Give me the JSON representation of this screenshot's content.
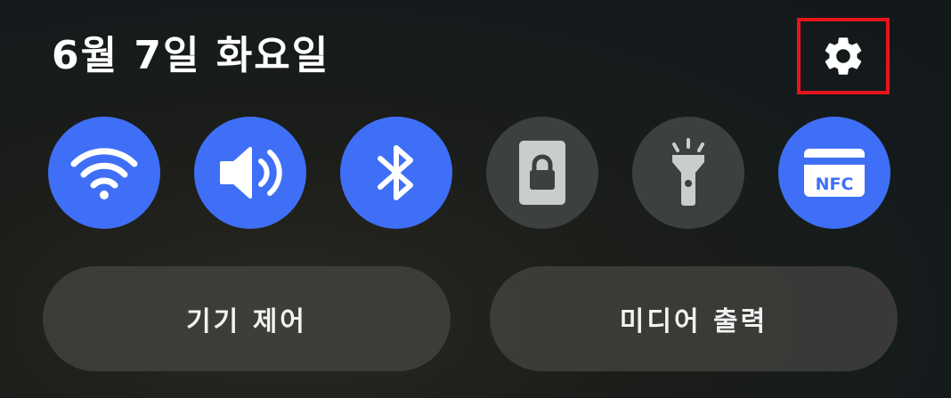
{
  "header": {
    "date": "6월 7일 화요일",
    "settings_icon": "gear-icon"
  },
  "quick_tiles": [
    {
      "name": "wifi",
      "icon": "wifi-icon",
      "state": "on"
    },
    {
      "name": "sound",
      "icon": "speaker-icon",
      "state": "on"
    },
    {
      "name": "bluetooth",
      "icon": "bluetooth-icon",
      "state": "on"
    },
    {
      "name": "screen-lock",
      "icon": "lock-icon",
      "state": "off"
    },
    {
      "name": "flashlight",
      "icon": "flashlight-icon",
      "state": "off"
    },
    {
      "name": "nfc",
      "icon": "nfc-icon",
      "state": "on",
      "label": "NFC"
    }
  ],
  "buttons": {
    "device_control": "기기 제어",
    "media_output": "미디어 출력"
  },
  "colors": {
    "tile_on": "#3f6ff6",
    "tile_off": "#3c4140",
    "highlight_border": "#e8141c"
  }
}
